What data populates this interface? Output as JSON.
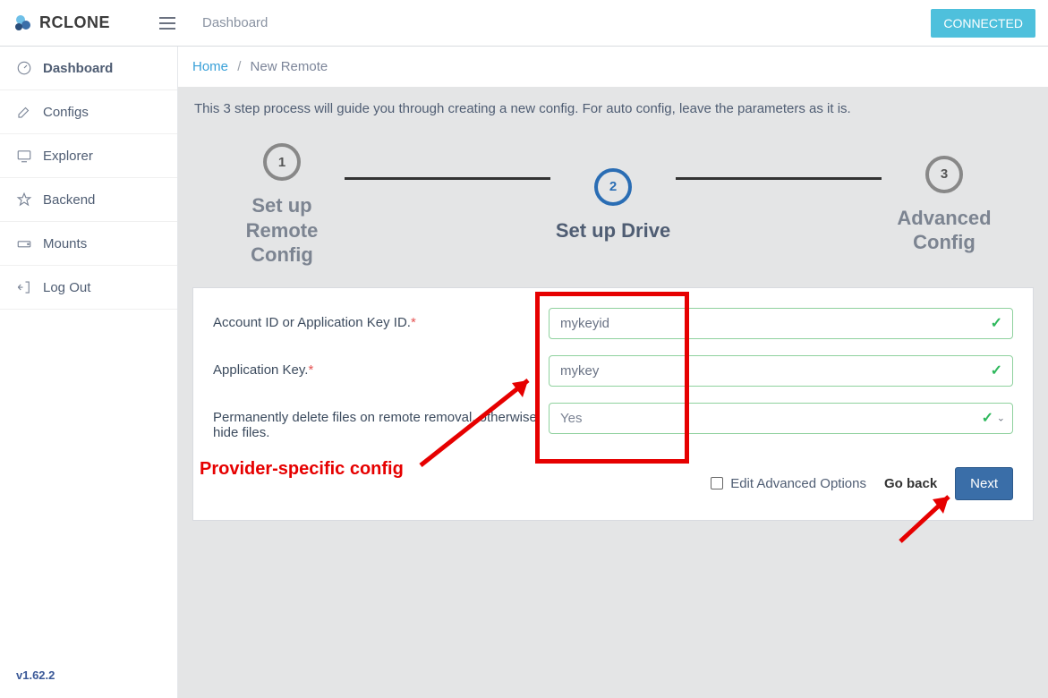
{
  "brand": "RCLONE",
  "header": {
    "title": "Dashboard",
    "status": "CONNECTED"
  },
  "sidebar": {
    "items": [
      {
        "label": "Dashboard"
      },
      {
        "label": "Configs"
      },
      {
        "label": "Explorer"
      },
      {
        "label": "Backend"
      },
      {
        "label": "Mounts"
      },
      {
        "label": "Log Out"
      }
    ]
  },
  "version": "v1.62.2",
  "breadcrumb": {
    "home": "Home",
    "current": "New Remote"
  },
  "help": "This 3 step process will guide you through creating a new config. For auto config, leave the parameters as it is.",
  "steps": [
    {
      "num": "1",
      "label": "Set up Remote Config"
    },
    {
      "num": "2",
      "label": "Set up Drive"
    },
    {
      "num": "3",
      "label": "Advanced Config"
    }
  ],
  "form": {
    "rows": [
      {
        "label": "Account ID or Application Key ID.",
        "required": true,
        "value": "mykeyid",
        "type": "text"
      },
      {
        "label": "Application Key.",
        "required": true,
        "value": "mykey",
        "type": "text"
      },
      {
        "label": "Permanently delete files on remote removal, otherwise hide files.",
        "required": false,
        "value": "Yes",
        "type": "select"
      }
    ],
    "advanced_label": "Edit Advanced Options",
    "goback": "Go back",
    "next": "Next"
  },
  "annotation": {
    "text": "Provider-specific config"
  }
}
